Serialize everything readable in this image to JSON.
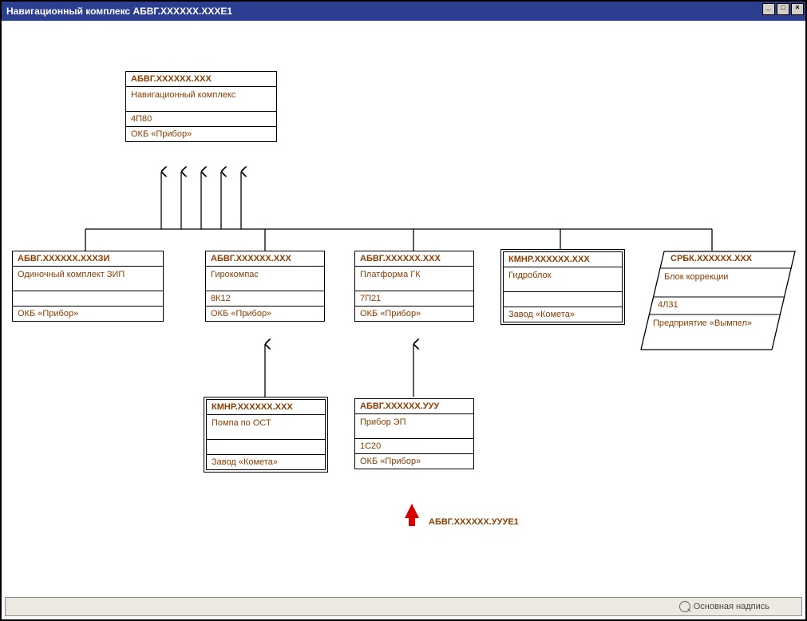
{
  "window": {
    "title": "Навигационный комплекс АБВГ.ХХХХХХ.ХХХЕ1"
  },
  "diagram": {
    "root": {
      "code": "АБВГ.ХХХХХХ.ХХХ",
      "name": "Навигационный комплекс",
      "serial": "4П80",
      "maker": "ОКБ «Прибор»"
    },
    "row1": {
      "zip": {
        "code": "АБВГ.ХХХХХХ.ХХХЗИ",
        "name": "Одиночный комплект ЗИП",
        "serial": "",
        "maker": "ОКБ «Прибор»"
      },
      "gyro": {
        "code": "АБВГ.ХХХХХХ.ХХХ",
        "name": "Гирокомпас",
        "serial": "8К12",
        "maker": "ОКБ «Прибор»"
      },
      "platform": {
        "code": "АБВГ.ХХХХХХ.ХХХ",
        "name": "Платформа ГК",
        "serial": "7П21",
        "maker": "ОКБ «Прибор»"
      },
      "hydro": {
        "code": "КМНР.ХХХХХХ.ХХХ",
        "name": "Гидроблок",
        "serial": "",
        "maker": "Завод «Комета»"
      },
      "corr": {
        "code": "СРБК.ХХХХХХ.ХХХ",
        "name": "Блок коррекции",
        "serial": "4Л31",
        "maker": "Предприятие «Вымпел»"
      }
    },
    "row2": {
      "pump": {
        "code": "КМНР.ХХХХХХ.ХХХ",
        "name": "Помпа по ОСТ",
        "serial": "",
        "maker": "Завод «Комета»"
      },
      "ep": {
        "code": "АБВГ.ХХХХХХ.УУУ",
        "name": "Прибор ЭП",
        "serial": "1С20",
        "maker": "ОКБ «Прибор»"
      }
    },
    "callout": "АБВГ.ХХХХХХ.УУУЕ1"
  },
  "statusbar": {
    "text": "Основная надпись"
  }
}
